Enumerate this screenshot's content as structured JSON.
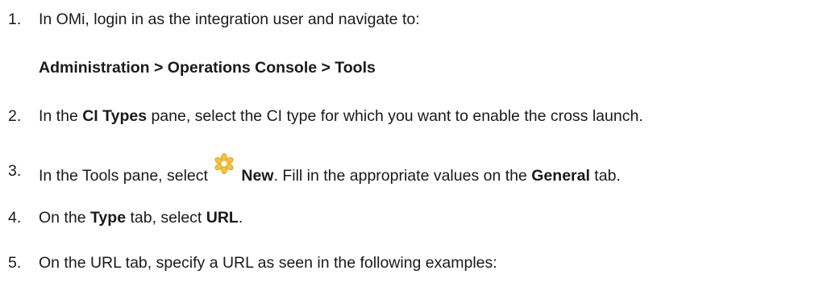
{
  "steps": [
    {
      "number": "1.",
      "text_a": "In OMi, login in as the integration user and navigate to:",
      "path": "Administration > Operations Console > Tools"
    },
    {
      "number": "2.",
      "text_a": "In the ",
      "bold_a": "CI Types",
      "text_b": " pane, select the CI type for which you want to enable the cross launch."
    },
    {
      "number": "3.",
      "text_a": "In the Tools pane, select ",
      "icon": "new-star-icon",
      "bold_a": "New",
      "text_b": ". Fill in the appropriate values on the ",
      "bold_b": "General",
      "text_c": " tab."
    },
    {
      "number": "4.",
      "text_a": "On the ",
      "bold_a": "Type",
      "text_b": " tab, select ",
      "bold_b": "URL",
      "text_c": "."
    },
    {
      "number": "5.",
      "text_a": "On the URL tab, specify a URL as seen in the following examples:"
    }
  ],
  "colors": {
    "text": "#1a1a1a",
    "icon_fill": "#f6c23a",
    "icon_center": "#ffffff"
  }
}
